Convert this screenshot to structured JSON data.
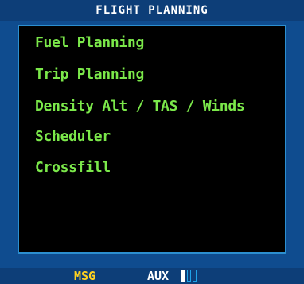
{
  "title_bar": {
    "title": "FLIGHT PLANNING"
  },
  "menu": {
    "items": [
      {
        "label": "Fuel Planning"
      },
      {
        "label": "Trip Planning"
      },
      {
        "label": "Density Alt / TAS / Winds"
      },
      {
        "label": "Scheduler"
      },
      {
        "label": "Crossfill"
      }
    ]
  },
  "status_bar": {
    "msg_label": "MSG",
    "aux_label": "AUX",
    "page_indicator": {
      "total_pages": 3,
      "current_page": 1
    }
  },
  "colors": {
    "screen_background": "#0f4c8f",
    "content_background": "#000000",
    "menu_text": "#7be84a",
    "msg_text": "#ffd21f",
    "aux_text": "#ffffff"
  }
}
